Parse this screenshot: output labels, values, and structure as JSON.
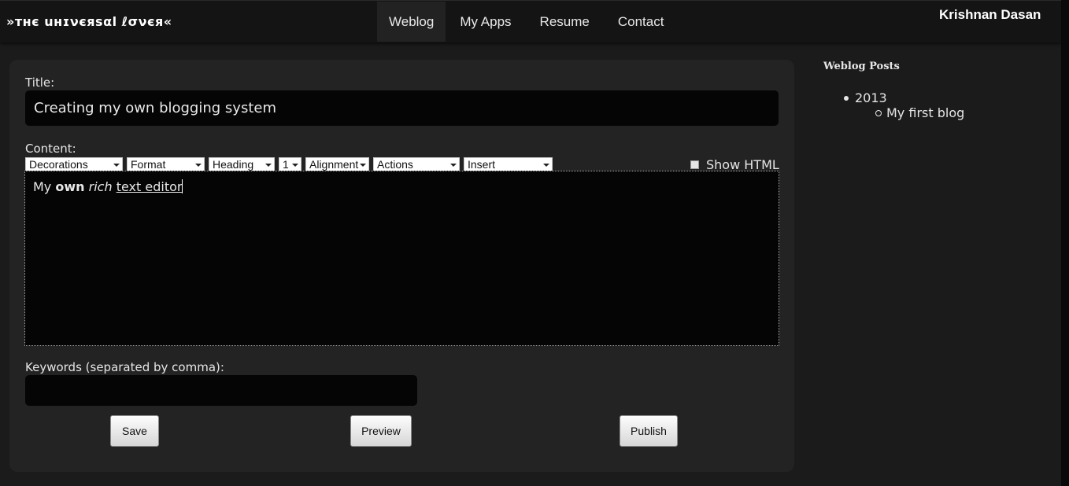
{
  "brand": "»тнє uнɪνєяsαl ℓσνєя«",
  "nav": [
    "Weblog",
    "My Apps",
    "Resume",
    "Contact"
  ],
  "nav_active": "Weblog",
  "user": "Krishnan Dasan",
  "form": {
    "title_label": "Title:",
    "title_value": "Creating my own blogging system",
    "content_label": "Content:",
    "toolbar": {
      "decorations": "Decorations",
      "format": "Format",
      "heading": "Heading",
      "size": "1",
      "alignment": "Alignment",
      "actions": "Actions",
      "insert": "Insert"
    },
    "show_html_label": "Show HTML",
    "editor": {
      "w1": "My",
      "w2": "own",
      "w3": "rich",
      "w4": "text editor"
    },
    "keywords_label": "Keywords (separated by comma):",
    "keywords_value": "",
    "save": "Save",
    "preview": "Preview",
    "publish": "Publish"
  },
  "sidebar": {
    "title": "Weblog Posts",
    "year": "2013",
    "post": "My first blog"
  },
  "colors": {
    "background": "#1b1b1b",
    "panel": "#232323",
    "input": "#050505"
  }
}
